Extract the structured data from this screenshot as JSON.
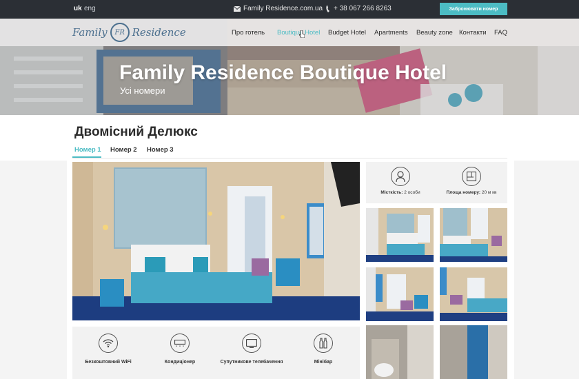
{
  "topbar": {
    "lang_uk": "uk",
    "lang_en": "eng",
    "email": "Family Residence.com.ua",
    "phone": "+ 38 067 266 8263",
    "book_label": "Забронювати номер"
  },
  "logo": {
    "left": "Family",
    "emblem": "FR",
    "right": "Residence"
  },
  "nav": {
    "items": [
      {
        "label": "Про готель",
        "active": false
      },
      {
        "label": "Boutique Hotel",
        "active": true
      },
      {
        "label": "Budget Hotel",
        "active": false
      },
      {
        "label": "Apartments",
        "active": false
      },
      {
        "label": "Beauty zone",
        "active": false
      },
      {
        "label": "Контакти",
        "active": false
      },
      {
        "label": "FAQ",
        "active": false
      }
    ]
  },
  "hero": {
    "title": "Family Residence Boutique Hotel",
    "subtitle": "Усі номери"
  },
  "room": {
    "title": "Двомісний Делюкс",
    "tabs": [
      "Номер 1",
      "Номер 2",
      "Номер 3"
    ],
    "active_tab": 0
  },
  "stats": {
    "capacity_label": "Місткість:",
    "capacity_value": "2 особи",
    "area_label": "Площа номеру:",
    "area_value": "20 м кв"
  },
  "features": [
    {
      "icon": "wifi-icon",
      "label": "Безкоштовний WiFi"
    },
    {
      "icon": "air-conditioner-icon",
      "label": "Кондиціонер"
    },
    {
      "icon": "tv-icon",
      "label": "Супутникове телебачення"
    },
    {
      "icon": "minibar-icon",
      "label": "Мінібар"
    }
  ],
  "colors": {
    "accent": "#4cbcc4",
    "topbar": "#2b2f35",
    "logo": "#4b6f8e"
  }
}
